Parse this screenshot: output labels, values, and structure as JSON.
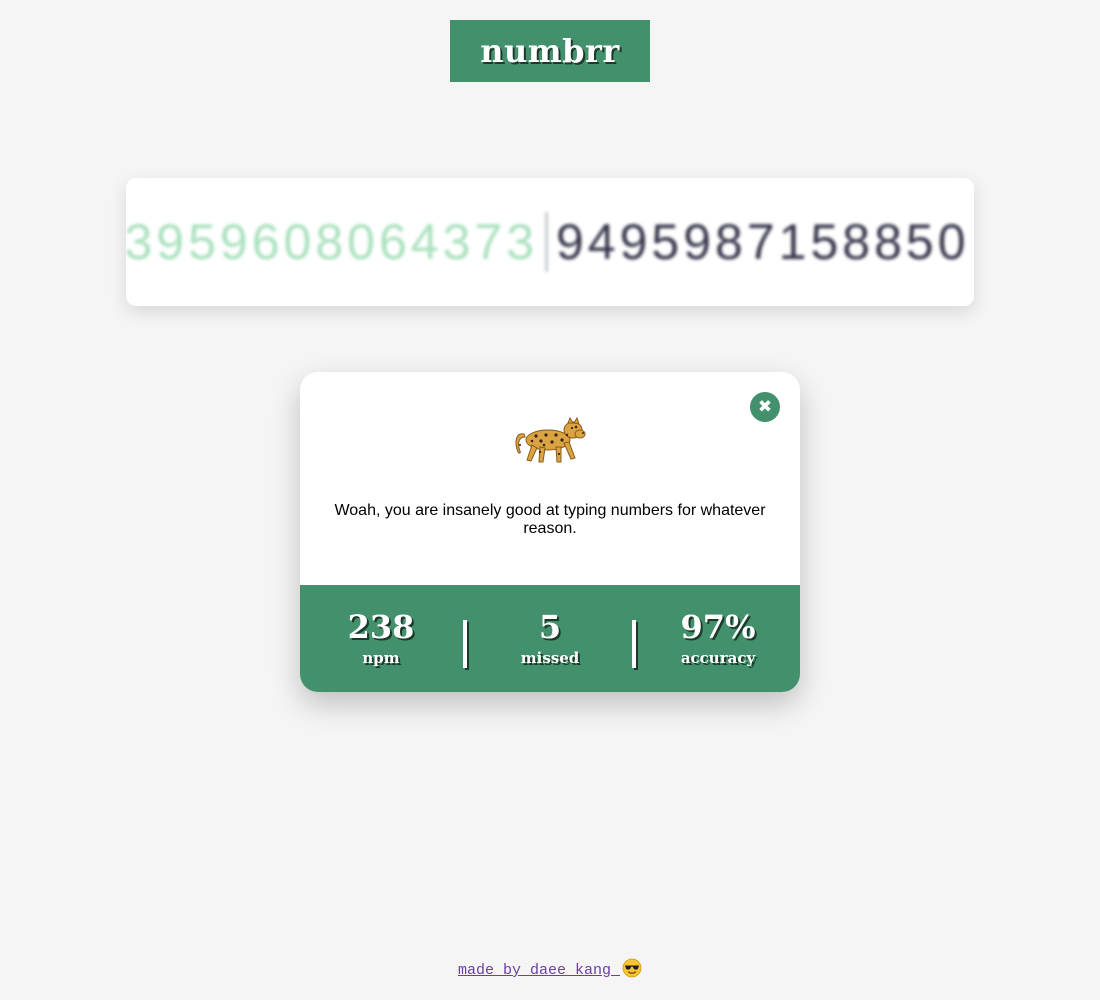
{
  "header": {
    "logo": "numbrr"
  },
  "typing": {
    "typed_digits": "3959608064373",
    "upcoming_digits": "9495987158850"
  },
  "modal": {
    "icon": "leopard-icon",
    "message": "Woah, you are insanely good at typing numbers for whatever reason.",
    "close_icon": "close-icon",
    "stats": {
      "npm_value": "238",
      "npm_label": "npm",
      "missed_value": "5",
      "missed_label": "missed",
      "accuracy_value": "97%",
      "accuracy_label": "accuracy"
    }
  },
  "footer": {
    "credit": "made by daee kang ",
    "emoji": "sunglasses-face-icon"
  },
  "colors": {
    "brand_green": "#42916c",
    "background": "#f5f5f5",
    "typed_digit": "#a9e0bd",
    "upcoming_digit": "#34344a",
    "link": "#6b3fa0"
  }
}
